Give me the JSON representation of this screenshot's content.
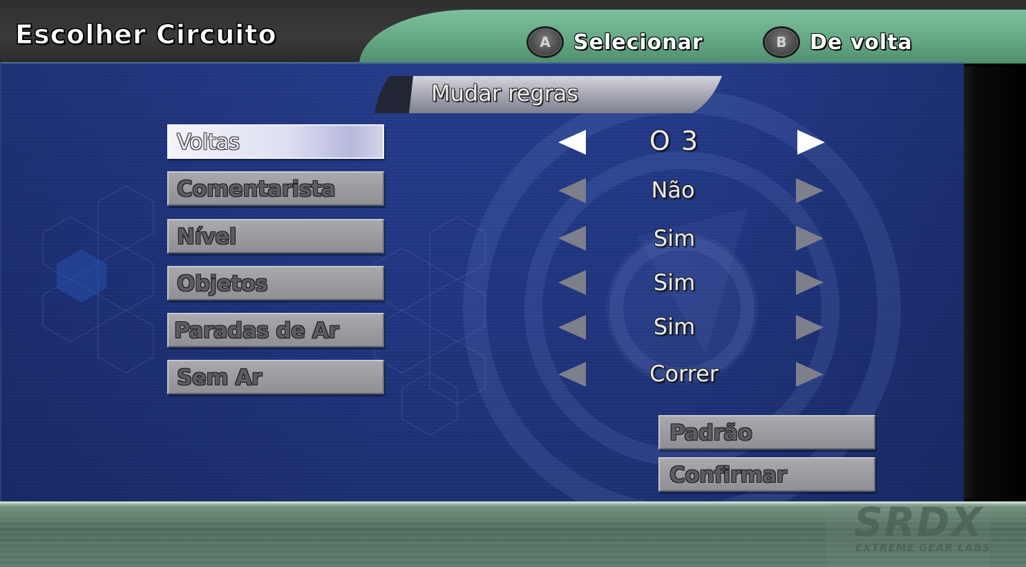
{
  "header": {
    "title": "Escolher Circuito",
    "hints": [
      {
        "button": "A",
        "label": "Selecionar"
      },
      {
        "button": "B",
        "label": "De volta"
      }
    ]
  },
  "section_title": "Mudar regras",
  "options": [
    {
      "label": "Voltas",
      "value": "O 3",
      "selected": true
    },
    {
      "label": "Comentarista",
      "value": "Não",
      "selected": false
    },
    {
      "label": "Nível",
      "value": "Sim",
      "selected": false
    },
    {
      "label": "Objetos",
      "value": "Sim",
      "selected": false
    },
    {
      "label": "Paradas de Ar",
      "value": "Sim",
      "selected": false
    },
    {
      "label": "Sem Ar",
      "value": "Correr",
      "selected": false
    }
  ],
  "actions": {
    "default_label": "Padrão",
    "confirm_label": "Confirmar"
  },
  "branding": {
    "logo": "SRDX",
    "tagline": "EXTREME GEAR LABS"
  },
  "colors": {
    "panel_blue": "#203580",
    "header_green": "#64a884",
    "button_grey": "#9b9ca2",
    "selected_button": "#e4e5f3"
  }
}
